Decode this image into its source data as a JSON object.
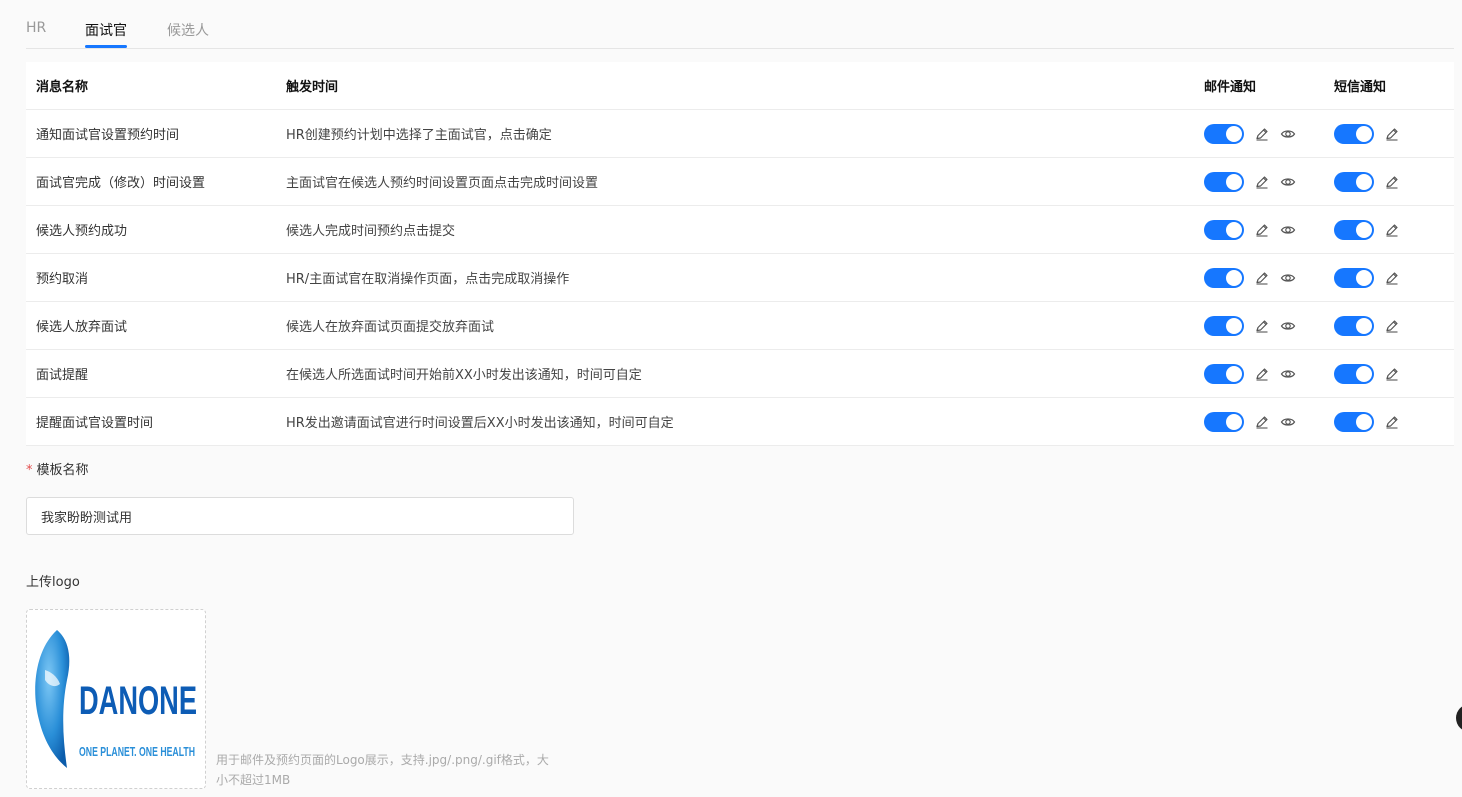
{
  "tabs": [
    {
      "label": "HR",
      "active": false
    },
    {
      "label": "面试官",
      "active": true
    },
    {
      "label": "候选人",
      "active": false
    }
  ],
  "table": {
    "columns": {
      "name": "消息名称",
      "trigger": "触发时间",
      "email": "邮件通知",
      "sms": "短信通知"
    },
    "rows": [
      {
        "name": "通知面试官设置预约时间",
        "trigger": "HR创建预约计划中选择了主面试官，点击确定",
        "email_on": true,
        "sms_on": true
      },
      {
        "name": "面试官完成（修改）时间设置",
        "trigger": "主面试官在候选人预约时间设置页面点击完成时间设置",
        "email_on": true,
        "sms_on": true
      },
      {
        "name": "候选人预约成功",
        "trigger": "候选人完成时间预约点击提交",
        "email_on": true,
        "sms_on": true
      },
      {
        "name": "预约取消",
        "trigger": "HR/主面试官在取消操作页面，点击完成取消操作",
        "email_on": true,
        "sms_on": true
      },
      {
        "name": "候选人放弃面试",
        "trigger": "候选人在放弃面试页面提交放弃面试",
        "email_on": true,
        "sms_on": true
      },
      {
        "name": "面试提醒",
        "trigger": "在候选人所选面试时间开始前XX小时发出该通知，时间可自定",
        "email_on": true,
        "sms_on": true
      },
      {
        "name": "提醒面试官设置时间",
        "trigger": "HR发出邀请面试官进行时间设置后XX小时发出该通知，时间可自定",
        "email_on": true,
        "sms_on": true
      }
    ]
  },
  "form": {
    "template_required_mark": "*",
    "template_label": "模板名称",
    "template_value": "我家盼盼测试用",
    "logo_label": "上传logo",
    "logo": {
      "brand": "DANONE",
      "tagline": "ONE PLANET. ONE HEALTH",
      "color": "#0d5cb5"
    },
    "upload_hint": "用于邮件及预约页面的Logo展示，支持.jpg/.png/.gif格式，大小不超过1MB"
  },
  "colors": {
    "accent": "#1677ff",
    "required": "#e34d4d"
  },
  "icons": {
    "edit": "edit-icon",
    "preview": "eye-icon"
  }
}
